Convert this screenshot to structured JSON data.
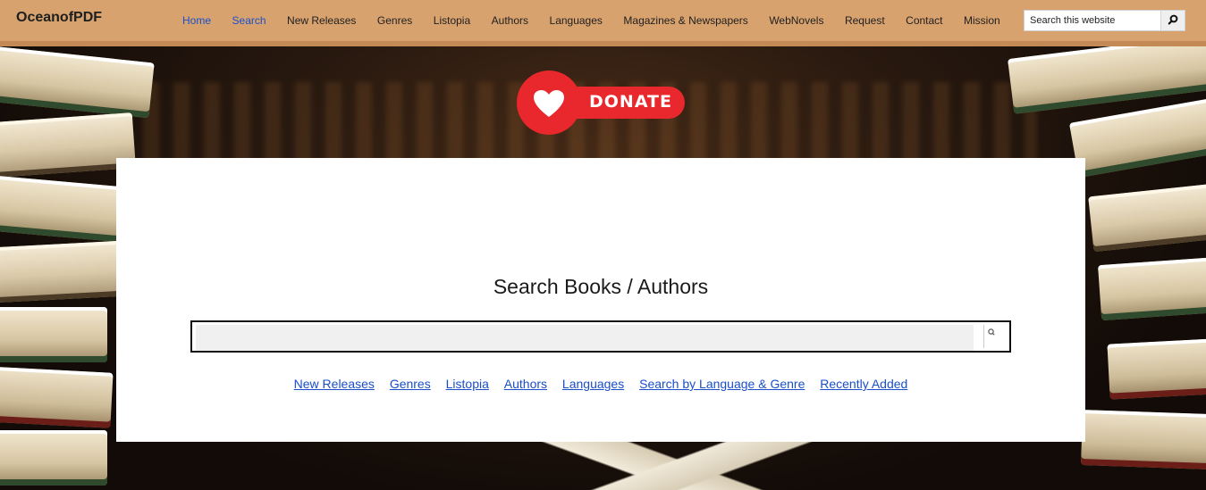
{
  "site": {
    "logo": "OceanofPDF"
  },
  "nav": {
    "items": [
      {
        "label": "Home",
        "active": true
      },
      {
        "label": "Search",
        "active": true
      },
      {
        "label": "New Releases"
      },
      {
        "label": "Genres"
      },
      {
        "label": "Listopia"
      },
      {
        "label": "Authors"
      },
      {
        "label": "Languages"
      },
      {
        "label": "Magazines & Newspapers"
      },
      {
        "label": "WebNovels"
      },
      {
        "label": "Request"
      },
      {
        "label": "Contact"
      },
      {
        "label": "Mission"
      }
    ]
  },
  "header_search": {
    "placeholder": "Search this website",
    "icon": "search-icon"
  },
  "donate": {
    "label": "DONATE",
    "icon": "heart-icon",
    "color": "#e8282c"
  },
  "search_card": {
    "title": "Search Books / Authors",
    "input_value": "",
    "links": [
      "New Releases",
      "Genres",
      "Listopia",
      "Authors",
      "Languages",
      "Search by Language & Genre",
      "Recently Added"
    ]
  },
  "colors": {
    "header_bg": "#d8a26f",
    "link": "#1a4fc9",
    "active_nav": "#1a4fc9"
  }
}
